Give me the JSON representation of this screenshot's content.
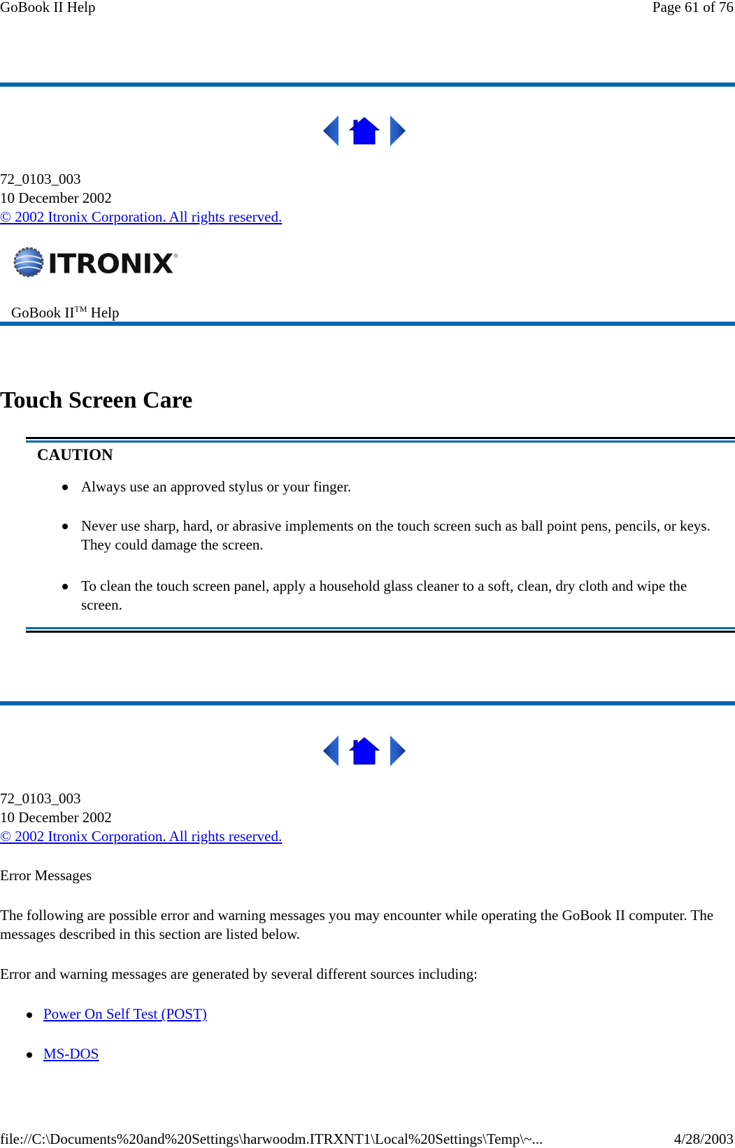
{
  "running_header": {
    "title": "GoBook II Help",
    "page": "Page 61 of 76"
  },
  "nav": {
    "prev_icon": "arrow-left-icon",
    "home_icon": "home-icon",
    "next_icon": "arrow-right-icon"
  },
  "top_meta": {
    "doc_number": "72_0103_003",
    "date": "10 December 2002",
    "copyright": "© 2002 Itronix Corporation.  All rights reserved."
  },
  "brand": {
    "logo_icon": "itronix-globe-icon",
    "logo_text": "ITRONIX",
    "logo_registered": "®",
    "product_title": "GoBook II",
    "product_tm": "TM",
    "product_suffix": " Help"
  },
  "section": {
    "title": "Touch Screen Care",
    "caution": {
      "label": "CAUTION",
      "items": [
        "Always use an approved stylus or your finger.",
        "Never use sharp, hard, or abrasive implements on the touch screen such as ball point pens, pencils, or keys.  They could damage the screen.",
        "To clean the touch screen panel, apply a household glass cleaner to a soft, clean, dry cloth and wipe the screen."
      ]
    }
  },
  "bottom_meta": {
    "doc_number": "72_0103_003",
    "date": "10 December 2002",
    "copyright": "© 2002 Itronix Corporation.  All rights reserved."
  },
  "error_section": {
    "heading": "Error Messages",
    "intro": "The following are possible error and warning messages you may encounter while operating the GoBook II computer.  The messages described in this section are listed below.",
    "sources_intro": "Error and warning messages are generated by several different sources including:",
    "links": [
      "Power On Self Test (POST)",
      "MS-DOS"
    ]
  },
  "running_footer": {
    "path": "file://C:\\Documents%20and%20Settings\\harwoodm.ITRXNT1\\Local%20Settings\\Temp\\~...",
    "date": "4/28/2003"
  },
  "colors": {
    "rule_blue": "#0066b3",
    "link_blue": "#0000ee",
    "nav_blue": "#1a4fc4",
    "home_blue": "#0000ff"
  }
}
